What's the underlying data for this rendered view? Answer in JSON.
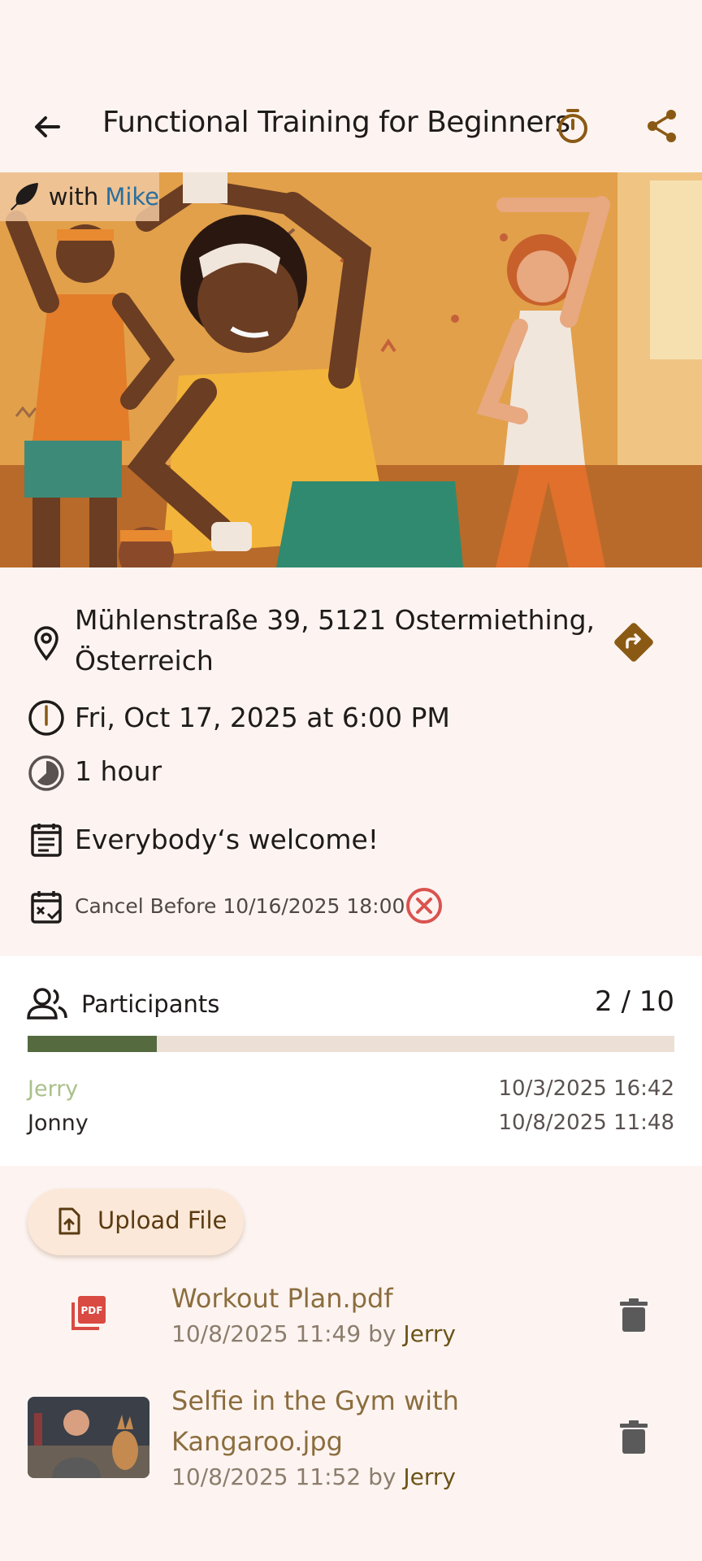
{
  "appbar": {
    "title": "Functional Training for Beginners",
    "back_icon": "arrow-left-icon",
    "timer_icon": "stopwatch-icon",
    "share_icon": "share-icon"
  },
  "hero": {
    "with_label": "with",
    "instructor": "Mike",
    "badge_icon": "feather-icon"
  },
  "details": {
    "address": [
      "Mühlenstraße 39, 5121 Ostermiething,",
      "Österreich"
    ],
    "datetime": "Fri, Oct 17, 2025 at 6:00 PM",
    "duration": "1 hour",
    "description": "Everybody‘s welcome!",
    "cancel_before": "Cancel Before 10/16/2025 18:00"
  },
  "participants": {
    "title": "Participants",
    "count_label": "2 / 10",
    "progress_fraction": 0.2,
    "list": [
      {
        "name": "Jerry",
        "date": "10/3/2025 16:42",
        "color": "#a9c08a"
      },
      {
        "name": "Jonny",
        "date": "10/8/2025 11:48",
        "color": "#2a2624"
      }
    ]
  },
  "files": {
    "upload_label": "Upload File",
    "items": [
      {
        "name": "Workout Plan.pdf",
        "date": "10/8/2025 11:49",
        "by": "by",
        "user": "Jerry",
        "type": "pdf"
      },
      {
        "name_lines": [
          "Selfie in the Gym with",
          "Kangaroo.jpg"
        ],
        "date": "10/8/2025 11:52",
        "by": "by",
        "user": "Jerry",
        "type": "image"
      }
    ]
  },
  "colors": {
    "background": "#fdf4f1",
    "accent_brown": "#8a5a14",
    "progress_fill": "#556b3f",
    "cancel_red": "#d9534f",
    "instructor_blue": "#2a6f9e"
  }
}
